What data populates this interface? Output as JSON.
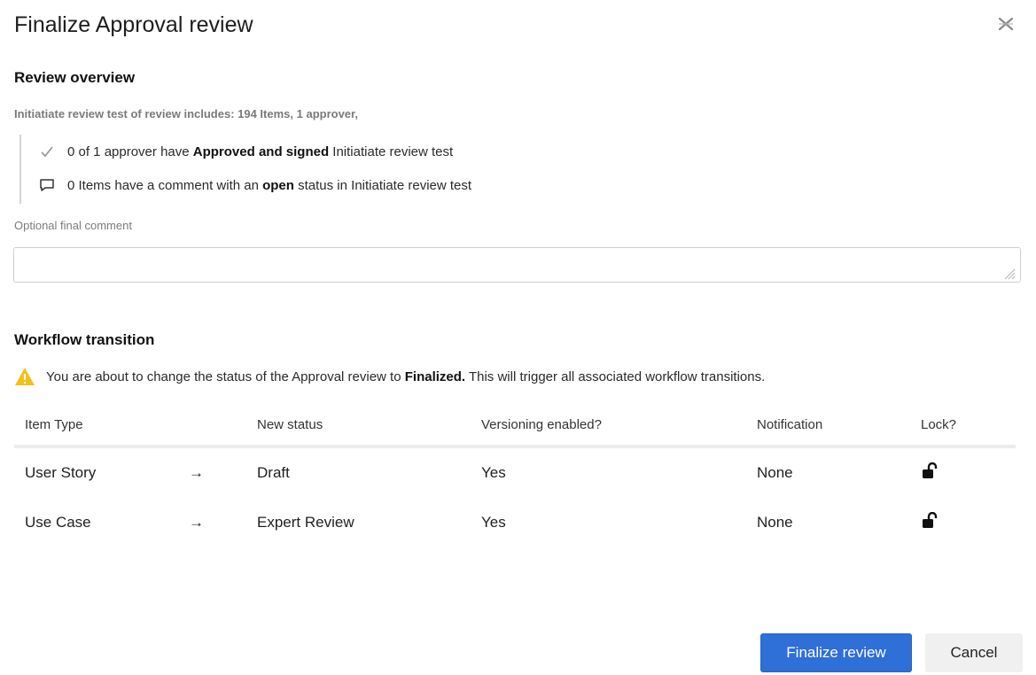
{
  "dialog": {
    "title": "Finalize Approval review"
  },
  "overview": {
    "heading": "Review overview",
    "summary": "Initiatiate review test of review includes: 194 Items, 1 approver,",
    "approved_line": {
      "prefix": "0 of 1 approver have ",
      "bold": "Approved and signed",
      "suffix": " Initiatiate review test",
      "icon": "checkmark-icon"
    },
    "comments_line": {
      "prefix": "0 Items have a comment with an ",
      "bold": "open",
      "suffix": " status in Initiatiate review test",
      "icon": "comment-icon"
    },
    "comment_label": "Optional final comment",
    "comment_value": ""
  },
  "workflow": {
    "heading": "Workflow transition",
    "warning": {
      "prefix": "You are about to change the status of the Approval review to ",
      "bold": "Finalized.",
      "suffix": " This will trigger all associated workflow transitions.",
      "icon": "warning-icon"
    },
    "columns": {
      "item_type": "Item Type",
      "new_status": "New status",
      "versioning": "Versioning enabled?",
      "notification": "Notification",
      "lock": "Lock?"
    },
    "rows": [
      {
        "item_type": "User Story",
        "arrow": "→",
        "new_status": "Draft",
        "versioning": "Yes",
        "notification": "None",
        "lock": "unlocked-padlock-icon"
      },
      {
        "item_type": "Use Case",
        "arrow": "→",
        "new_status": "Expert Review",
        "versioning": "Yes",
        "notification": "None",
        "lock": "unlocked-padlock-icon"
      }
    ]
  },
  "footer": {
    "finalize_label": "Finalize review",
    "cancel_label": "Cancel"
  },
  "colors": {
    "primary_button": "#2e6fd8",
    "warning": "#f2c21b"
  }
}
